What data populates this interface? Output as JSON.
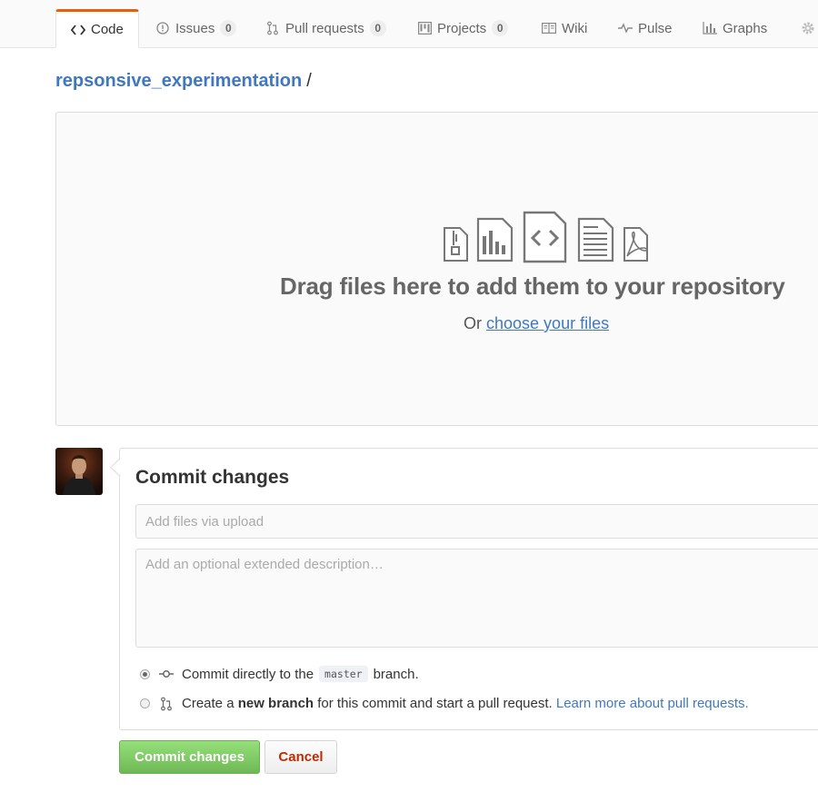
{
  "nav": {
    "tabs": [
      {
        "label": "Code",
        "icon": "code-icon",
        "active": true
      },
      {
        "label": "Issues",
        "icon": "issue-icon",
        "count": "0"
      },
      {
        "label": "Pull requests",
        "icon": "pull-request-icon",
        "count": "0"
      },
      {
        "label": "Projects",
        "icon": "project-icon",
        "count": "0"
      },
      {
        "label": "Wiki",
        "icon": "book-icon"
      },
      {
        "label": "Pulse",
        "icon": "pulse-icon"
      },
      {
        "label": "Graphs",
        "icon": "graph-icon"
      }
    ],
    "settings_icon": "gear-icon"
  },
  "breadcrumb": {
    "repo": "repsonsive_experimentation",
    "separator": "/"
  },
  "dropzone": {
    "icons": [
      "file-zip-icon",
      "file-chart-icon",
      "file-code-icon",
      "file-text-icon",
      "file-pdf-icon"
    ],
    "title": "Drag files here to add them to your repository",
    "subtitle_prefix": "Or",
    "subtitle_link": "choose your files"
  },
  "commit": {
    "title": "Commit changes",
    "summary_placeholder": "Add files via upload",
    "description_placeholder": "Add an optional extended description…",
    "option_direct": {
      "prefix": "Commit directly to the",
      "branch": "master",
      "suffix": "branch.",
      "selected": true
    },
    "option_new": {
      "prefix": "Create a",
      "bold": "new branch",
      "suffix": "for this commit and start a pull request.",
      "link": "Learn more about pull requests.",
      "selected": false
    }
  },
  "buttons": {
    "commit": "Commit changes",
    "cancel": "Cancel"
  },
  "colors": {
    "accent": "#e36209",
    "link": "#4078c0",
    "primary_button": "#6cc644",
    "cancel_text": "#bd2c00"
  }
}
